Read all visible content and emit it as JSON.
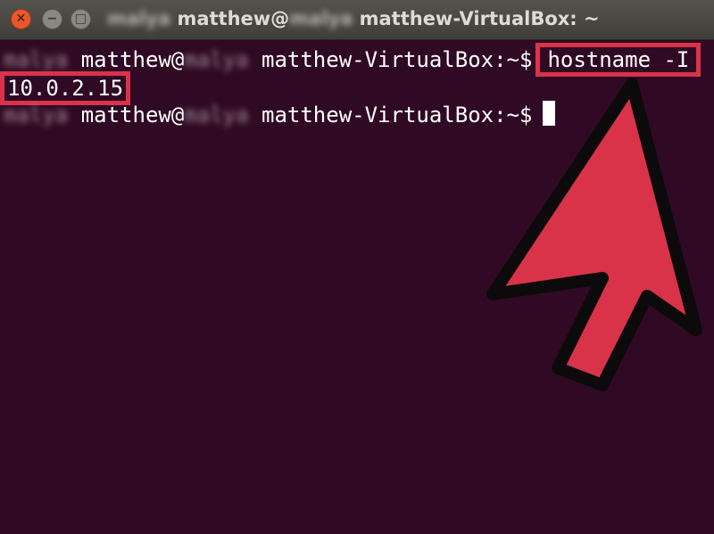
{
  "window": {
    "title_blurred_prefix": "malya",
    "title_user": "matthew@",
    "title_blurred_middle": "malya",
    "title_host": "matthew-VirtualBox: ~",
    "controls": {
      "close_glyph": "✕",
      "minimize_glyph": "−",
      "maximize_glyph": "□"
    }
  },
  "terminal": {
    "background": "#300a24",
    "lines": [
      {
        "blurred_prefix": "malya",
        "user": "matthew@",
        "blurred_middle": "malya",
        "host_path": "matthew-VirtualBox:~$",
        "command": "hostname -I"
      },
      {
        "output": "10.0.2.15"
      },
      {
        "blurred_prefix": "malya",
        "user": "matthew@",
        "blurred_middle": "malya",
        "host_path": "matthew-VirtualBox:~$"
      }
    ]
  },
  "annotation": {
    "highlight_color": "#d9334a",
    "arrow_icon": "up-left-arrow-icon"
  }
}
